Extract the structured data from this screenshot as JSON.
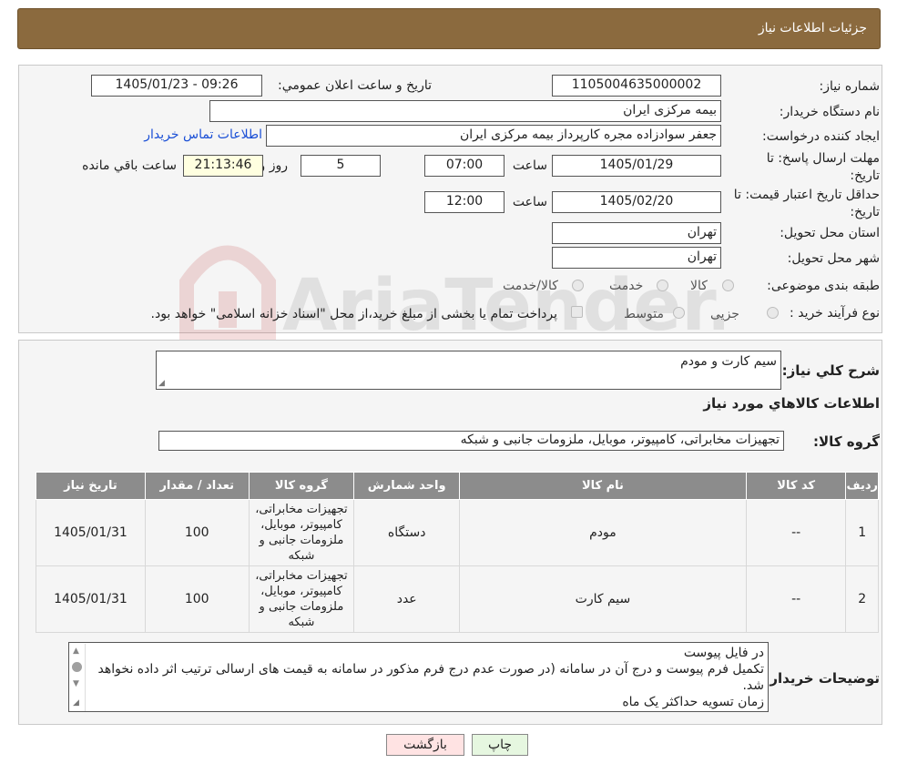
{
  "header": {
    "title": "جزئیات اطلاعات نیاز"
  },
  "form": {
    "need_number_label": "شماره نیاز:",
    "need_number": "1105004635000002",
    "announce_label": "تاریخ و ساعت اعلان عمومي:",
    "announce_value": "1405/01/23 - 09:26",
    "buyer_label": "نام دستگاه خريدار:",
    "buyer_value": "بیمه مرکزی ایران",
    "creator_label": "ايجاد كننده درخواست:",
    "creator_value": "جعفر سوادزاده مجره کارپرداز بیمه مرکزی ایران",
    "contact_link": "اطلاعات تماس خريدار",
    "deadline_label_1": "مهلت ارسال پاسخ: تا",
    "deadline_label_2": "تاريخ:",
    "deadline_date": "1405/01/29",
    "time_label": "ساعت",
    "deadline_time": "07:00",
    "days_value": "5",
    "days_label": "روز و",
    "remaining_time": "21:13:46",
    "remaining_label": "ساعت باقي مانده",
    "validity_label_1": "حداقل تاريخ اعتبار قيمت: تا",
    "validity_label_2": "تاريخ:",
    "validity_date": "1405/02/20",
    "validity_time": "12:00",
    "province_label": "استان محل تحويل:",
    "province_value": "تهران",
    "city_label": "شهر محل تحويل:",
    "city_value": "تهران",
    "category_label": "طبقه بندی موضوعی:",
    "category_options": [
      "کالا",
      "خدمت",
      "کالا/خدمت"
    ],
    "process_label": "نوع فرآيند خريد :",
    "process_options": [
      "جزیی",
      "متوسط"
    ],
    "process_note": "پرداخت تمام یا بخشی از مبلغ خرید،از محل \"اسناد خزانه اسلامی\" خواهد بود."
  },
  "details": {
    "summary_label": "شرح كلي نياز:",
    "summary_value": "سیم کارت و مودم",
    "goods_info_title": "اطلاعات كالاهاي مورد نياز",
    "goods_group_label": "گروه كالا:",
    "goods_group_value": "تجهیزات مخابراتی، کامپیوتر، موبایل، ملزومات جانبی و شبکه"
  },
  "table": {
    "headers": [
      "رديف",
      "كد كالا",
      "نام كالا",
      "واحد شمارش",
      "گروه كالا",
      "تعداد / مقدار",
      "تاريخ نياز"
    ],
    "rows": [
      [
        "1",
        "--",
        "مودم",
        "دستگاه",
        "تجهیزات مخابراتی، کامپیوتر، موبایل، ملزومات جانبی و شبکه",
        "100",
        "1405/01/31"
      ],
      [
        "2",
        "--",
        "سیم کارت",
        "عدد",
        "تجهیزات مخابراتی، کامپیوتر، موبایل، ملزومات جانبی و شبکه",
        "100",
        "1405/01/31"
      ]
    ]
  },
  "notes": {
    "label": "توضيحات خريدار:",
    "lines": [
      "در فایل پیوست",
      "تکمیل فرم پیوست و درج آن در سامانه (در صورت عدم درج فرم مذکور در سامانه به قیمت های ارسالی ترتیب اثر داده نخواهد شد.",
      "زمان تسویه حداکثر یک ماه"
    ]
  },
  "buttons": {
    "print": "چاپ",
    "back": "بازگشت"
  },
  "watermark_text": "AriaTender.neT",
  "colors": {
    "header_bg": "#8b6a3e",
    "table_header_bg": "#8c8c8c",
    "link": "#1a4fd6",
    "back_button_bg": "#ffe3e3",
    "print_button_bg": "#e6f7e0"
  }
}
